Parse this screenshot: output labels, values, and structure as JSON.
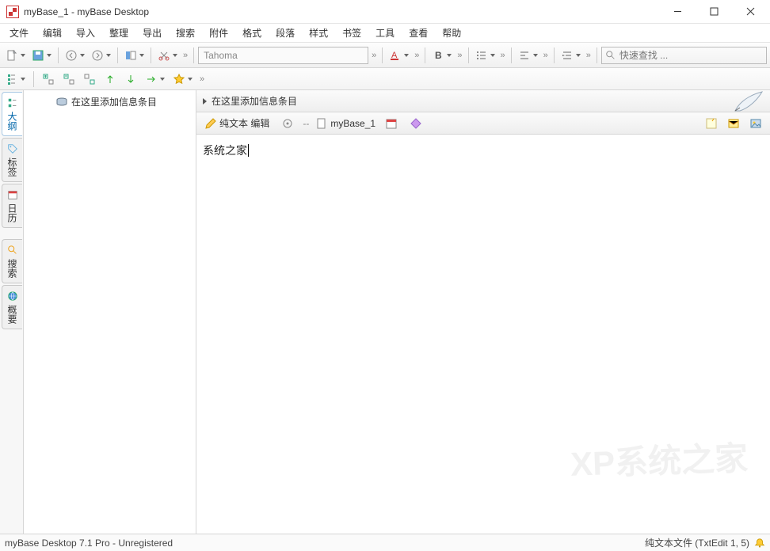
{
  "window": {
    "title": "myBase_1 - myBase Desktop"
  },
  "menu": {
    "items": [
      "文件",
      "编辑",
      "导入",
      "整理",
      "导出",
      "搜索",
      "附件",
      "格式",
      "段落",
      "样式",
      "书签",
      "工具",
      "查看",
      "帮助"
    ]
  },
  "toolbar": {
    "font": "Tahoma",
    "search_placeholder": "快速查找 ..."
  },
  "side_tabs": [
    {
      "label": "大纲",
      "active": true
    },
    {
      "label": "标签",
      "active": false
    },
    {
      "label": "日历",
      "active": false
    },
    {
      "label": "搜索",
      "active": false
    },
    {
      "label": "概要",
      "active": false
    }
  ],
  "tree": {
    "items": [
      {
        "label": "在这里添加信息条目"
      }
    ]
  },
  "crumb": {
    "label": "在这里添加信息条目"
  },
  "mode": {
    "edit_label": "纯文本 编辑",
    "doc_name": "myBase_1",
    "sep": "--"
  },
  "editor": {
    "content": "系统之家"
  },
  "status": {
    "left": "myBase Desktop 7.1 Pro - Unregistered",
    "right": "纯文本文件 (TxtEdit 1, 5)"
  },
  "watermark": "XP系统之家"
}
